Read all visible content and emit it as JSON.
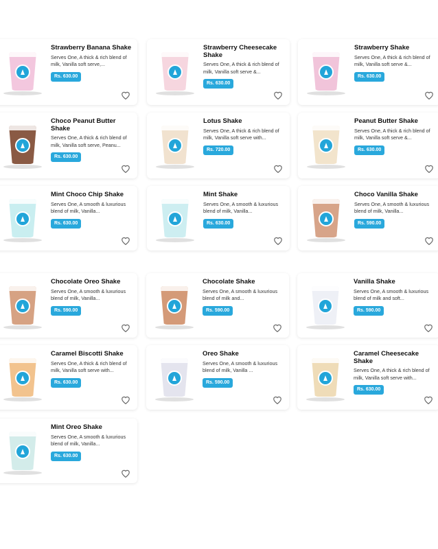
{
  "colors": {
    "price_badge": "#29a8dc",
    "logo": "#22a5d9"
  },
  "products": [
    {
      "name": "Strawberry Banana Shake",
      "desc": "Serves One, A thick & rich blend of milk, Vanilla soft serve,...",
      "price": "Rs. 630.00",
      "cup_color": "#f3c7de",
      "icon": "heart-icon"
    },
    {
      "name": "Strawberry Cheesecake Shake",
      "desc": "Serves One, A thick & rich blend of milk, Vanilla soft serve &...",
      "price": "Rs. 630.00",
      "cup_color": "#f6d6df",
      "icon": "heart-icon"
    },
    {
      "name": "Strawberry Shake",
      "desc": "Serves One, A thick & rich blend of milk, Vanilla soft serve &...",
      "price": "Rs. 630.00",
      "cup_color": "#f1c4da",
      "icon": "heart-icon"
    },
    {
      "name": "Choco Peanut Butter Shake",
      "desc": "Serves One, A thick & rich blend of milk, Vanilla soft serve, Peanu...",
      "price": "Rs. 630.00",
      "cup_color": "#8a5a44",
      "icon": "heart-icon"
    },
    {
      "name": "Lotus Shake",
      "desc": "Serves One, A thick & rich blend of milk, Vanilla soft serve with...",
      "price": "Rs. 720.00",
      "cup_color": "#f1e2cf",
      "icon": "heart-icon"
    },
    {
      "name": "Peanut Butter Shake",
      "desc": "Serves One, A thick & rich blend of milk, Vanilla soft serve &...",
      "price": "Rs. 630.00",
      "cup_color": "#f2e4cc",
      "icon": "heart-icon"
    },
    {
      "name": "Mint Choco Chip Shake",
      "desc": "Serves One, A smooth & luxurious blend of milk, Vanilla...",
      "price": "Rs. 630.00",
      "cup_color": "#c9eef0",
      "icon": "heart-icon"
    },
    {
      "name": "Mint Shake",
      "desc": "Serves One, A smooth & luxurious blend of milk, Vanilla...",
      "price": "Rs. 630.00",
      "cup_color": "#cdeef1",
      "icon": "heart-icon"
    },
    {
      "name": "Choco Vanilla Shake",
      "desc": "Serves One, A smooth & luxurious blend of milk, Vanilla...",
      "price": "Rs. 590.00",
      "cup_color": "#d7a489",
      "icon": "heart-icon"
    },
    {
      "name": "Chocolate Oreo Shake",
      "desc": "Serves One, A smooth & luxurious blend of milk, Vanilla...",
      "price": "Rs. 590.00",
      "cup_color": "#d6a283",
      "icon": "heart-icon"
    },
    {
      "name": "Chocolate Shake",
      "desc": "Serves One, A smooth & luxurious blend of milk and...",
      "price": "Rs. 590.00",
      "cup_color": "#d49a78",
      "icon": "heart-icon"
    },
    {
      "name": "Vanilla Shake",
      "desc": "Serves One, A smooth & luxurious blend of milk and soft...",
      "price": "Rs. 590.00",
      "cup_color": "#eef0f6",
      "icon": "heart-icon"
    },
    {
      "name": "Caramel Biscotti Shake",
      "desc": "Serves One, A thick & rich blend of milk, Vanilla soft serve with...",
      "price": "Rs. 630.00",
      "cup_color": "#f2c38e",
      "icon": "heart-icon"
    },
    {
      "name": "Oreo Shake",
      "desc": "Serves One, A smooth & luxurious blend of milk, Vanilla ...",
      "price": "Rs. 590.00",
      "cup_color": "#e4e4ee",
      "icon": "heart-icon"
    },
    {
      "name": "Caramel Cheesecake Shake",
      "desc": "Serves One, A thick & rich blend of milk, Vanilla soft serve with...",
      "price": "Rs. 630.00",
      "cup_color": "#efdcb8",
      "icon": "heart-icon"
    },
    {
      "name": "Mint Oreo Shake",
      "desc": "Serves One, A smooth & luxurious blend of milk, Vanilla...",
      "price": "Rs. 630.00",
      "cup_color": "#d3ecea",
      "icon": "heart-icon"
    }
  ]
}
